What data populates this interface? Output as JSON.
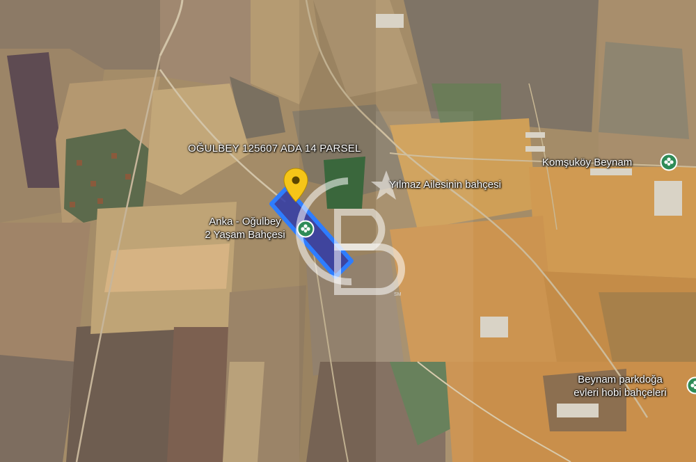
{
  "parcel": {
    "title": "OĞULBEY 125607 ADA 14 PARSEL",
    "fill_color": "#2f3aa8",
    "outline_color": "#2e7dff"
  },
  "places": [
    {
      "id": "anka",
      "lines": [
        "Anka - Oğulbey",
        "2 Yaşam Bahçesi"
      ],
      "icon": "park-marker-icon"
    },
    {
      "id": "yilmaz",
      "lines": [
        "Yılmaz Ailesinin bahçesi"
      ],
      "icon": "none"
    },
    {
      "id": "komsukoy",
      "lines": [
        "Komşuköy Beynam"
      ],
      "icon": "park-marker-icon"
    },
    {
      "id": "beynam",
      "lines": [
        "Beynam parkdoğa",
        "evleri hobi bahçeleri"
      ],
      "icon": "park-marker-icon"
    }
  ],
  "marker": {
    "icon": "yellow-location-pin-icon",
    "color": "#f5c518"
  },
  "watermark": {
    "text": "CB",
    "suffix": "SM"
  },
  "colors": {
    "poi_green": "#2e8b57",
    "fields_light": "#d4ad6e",
    "fields_dark": "#6b5b4a"
  }
}
